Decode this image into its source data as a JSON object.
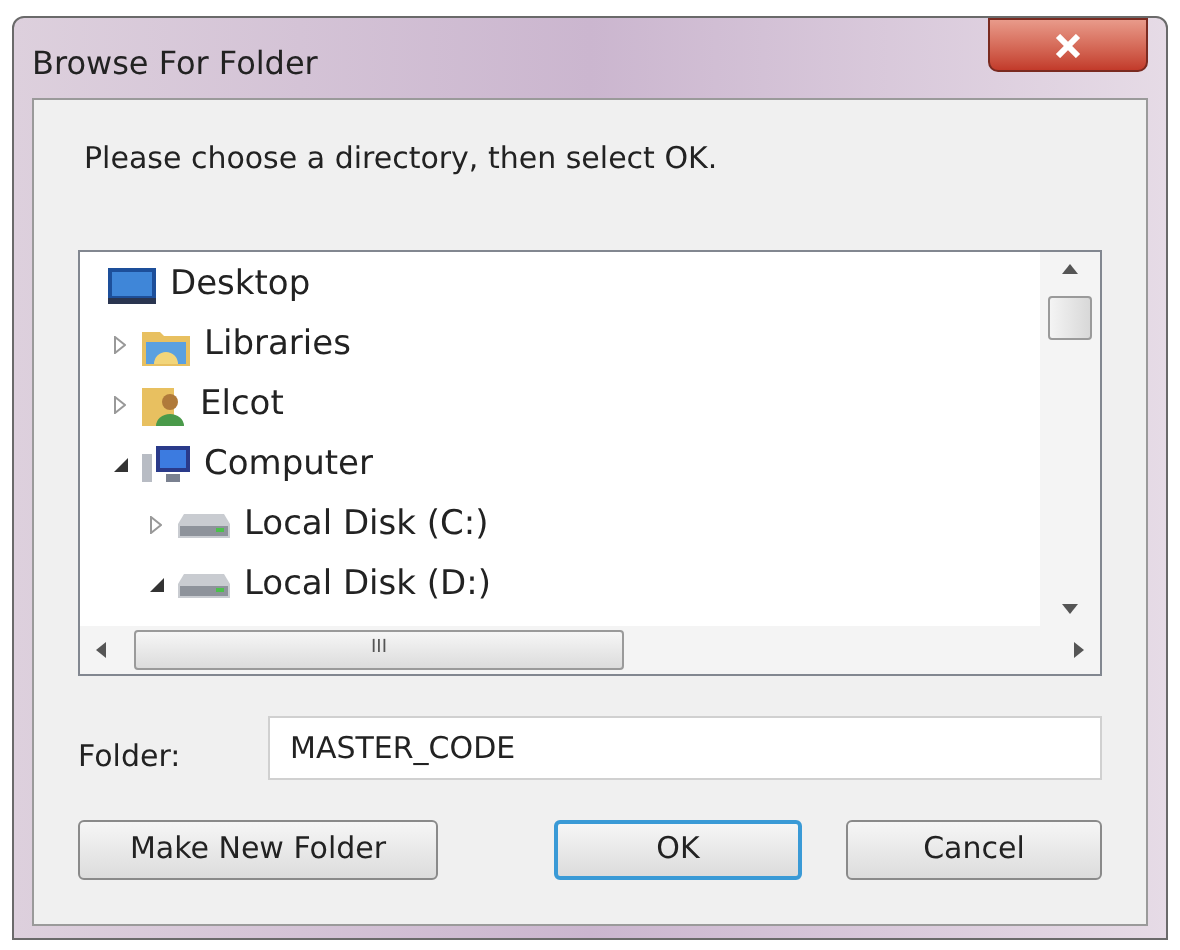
{
  "window": {
    "title": "Browse For Folder"
  },
  "instruction": "Please choose a directory, then select OK.",
  "tree": [
    {
      "label": "Desktop",
      "kind": "desktop",
      "children": [
        {
          "label": "Libraries",
          "kind": "libraries",
          "expanded": false
        },
        {
          "label": "Elcot",
          "kind": "user",
          "expanded": false
        },
        {
          "label": "Computer",
          "kind": "computer",
          "expanded": true,
          "children": [
            {
              "label": "Local Disk (C:)",
              "kind": "drive",
              "expanded": false
            },
            {
              "label": "Local Disk (D:)",
              "kind": "drive",
              "expanded": true
            }
          ]
        }
      ]
    }
  ],
  "hscroll_grip": "III",
  "folder": {
    "label": "Folder:",
    "value": "MASTER_CODE"
  },
  "buttons": [
    {
      "label": "Make New Folder",
      "default": false
    },
    {
      "label": "OK",
      "default": true
    },
    {
      "label": "Cancel",
      "default": false
    }
  ]
}
